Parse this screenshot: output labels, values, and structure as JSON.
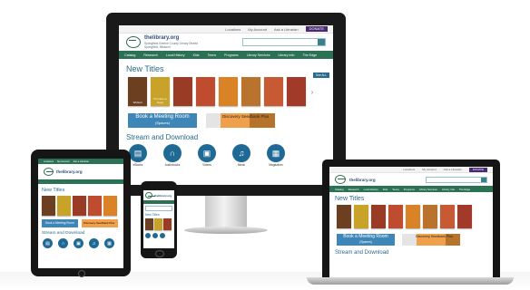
{
  "site": {
    "name": "thelibrary.org",
    "subtitle": "Springfield-Greene County Library District",
    "subtitle2": "Springfield, Missouri"
  },
  "top_links": [
    "Locations",
    "My Account",
    "Ask a Librarian"
  ],
  "donate_label": "DONATE",
  "nav": [
    "Catalog",
    "Research",
    "Local History",
    "Kids",
    "Teens",
    "Programs",
    "Library Services",
    "Library Info",
    "The Edge"
  ],
  "new_titles": {
    "heading": "New Titles",
    "see_all": "See ALL"
  },
  "books": [
    {
      "title": "Wicked",
      "color": "#6b3f1f"
    },
    {
      "title": "Promise to Keep",
      "color": "#c9a22a"
    },
    {
      "title": "",
      "color": "#9a3b26"
    },
    {
      "title": "",
      "color": "#c04c2f"
    },
    {
      "title": "",
      "color": "#d98326"
    },
    {
      "title": "",
      "color": "#b9732c"
    },
    {
      "title": "",
      "color": "#c85a33"
    },
    {
      "title": "",
      "color": "#a23a2a"
    }
  ],
  "banners": {
    "meeting_label": "Book a Meeting Room",
    "meeting_sub": "(Spaces)",
    "discover_label": "Discovery Seedbank Plus"
  },
  "stream": {
    "heading": "Stream and Download",
    "items": [
      {
        "label": "eBooks",
        "icon": "book-icon"
      },
      {
        "label": "Audiobooks",
        "icon": "headphones-icon"
      },
      {
        "label": "Videos",
        "icon": "film-icon"
      },
      {
        "label": "Music",
        "icon": "music-icon"
      },
      {
        "label": "Magazines",
        "icon": "magazine-icon"
      }
    ]
  },
  "colors": {
    "nav_green": "#2b7255",
    "title_blue": "#2a6a8c",
    "donate_purple": "#4b2a74",
    "circle_blue": "#1f6a95"
  }
}
